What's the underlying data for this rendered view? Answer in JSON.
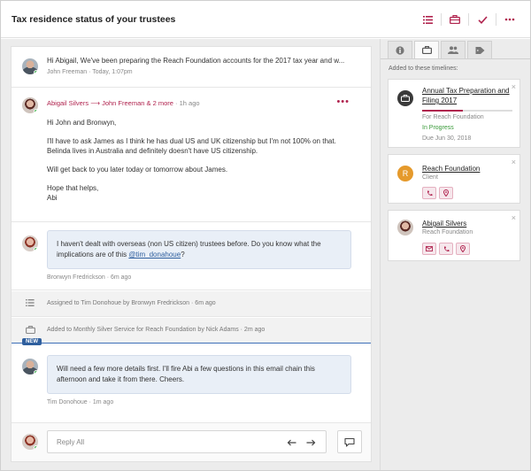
{
  "header": {
    "title": "Tax residence status of your trustees"
  },
  "thread": {
    "first": {
      "snippet": "Hi Abigail, We've been preparing the Reach Foundation accounts for the 2017 tax year and w...",
      "meta": "John Freeman · Today, 1:07pm"
    },
    "email": {
      "from": "Abigail Silvers",
      "arrow": "⟶",
      "to": "John Freeman & 2 more",
      "ago": "· 1h ago",
      "more": "•••",
      "paragraphs": [
        "Hi John and Bronwyn,",
        "I'll have to ask James as I think he has dual US and UK citizenship but I'm not 100% on that. Belinda lives in Australia and definitely doesn't have US citizenship.",
        "Will get back to you later today or tomorrow about James.",
        "Hope that helps,"
      ],
      "signature": "Abi"
    },
    "comment1": {
      "text_before": "I haven't dealt with overseas (non US citizen) trustees before. Do you know what the implications are of this ",
      "mention": "@tim_donahoue",
      "text_after": "?",
      "meta": "Bronwyn Fredrickson · 6m ago"
    },
    "activity1": "Assigned to Tim Donohoue by Bronwyn Fredrickson · 6m ago",
    "activity2": "Added to Monthly Silver Service for Reach Foundation by Nick Adams · 2m ago",
    "new_badge": "NEW",
    "comment2": {
      "text": "Will need a few more details first. I'll fire Abi a few questions in this email chain this afternoon and take it from there. Cheers.",
      "meta": "Tim Donohoue · 1m ago"
    },
    "reply_placeholder": "Reply All"
  },
  "sidebar": {
    "added_label": "Added to these timelines:",
    "timeline": {
      "title": "Annual Tax Preparation and Filing 2017",
      "for": "For Reach Foundation",
      "status": "In Progress",
      "due": "Due Jun 30, 2018",
      "progress": 0.45,
      "status_color": "#3a9a3a"
    },
    "client": {
      "initial": "R",
      "name": "Reach Foundation",
      "role": "Client"
    },
    "contact": {
      "name": "Abigail Silvers",
      "org": "Reach Foundation"
    },
    "close": "×"
  },
  "colors": {
    "accent": "#b0234e",
    "client_avatar": "#e59a2c",
    "mention": "#2f5f9e"
  }
}
